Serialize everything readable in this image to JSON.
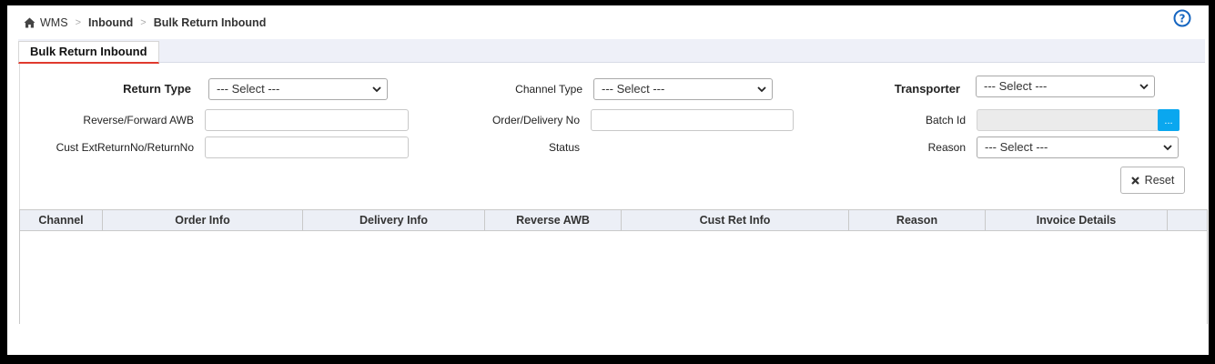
{
  "breadcrumb": {
    "root": "WMS",
    "sep": ">",
    "level1": "Inbound",
    "current": "Bulk Return Inbound"
  },
  "tab": {
    "label": "Bulk Return Inbound"
  },
  "filters": {
    "return_type": {
      "label": "Return Type",
      "value": "--- Select ---"
    },
    "channel_type": {
      "label": "Channel Type",
      "value": "--- Select ---"
    },
    "transporter": {
      "label": "Transporter",
      "value": "--- Select ---"
    },
    "reverse_awb": {
      "label": "Reverse/Forward AWB",
      "value": ""
    },
    "order_delivery": {
      "label": "Order/Delivery No",
      "value": ""
    },
    "batch_id": {
      "label": "Batch Id",
      "value": "",
      "button": "..."
    },
    "cust_ret": {
      "label": "Cust ExtReturnNo/ReturnNo",
      "value": ""
    },
    "status": {
      "label": "Status"
    },
    "reason": {
      "label": "Reason",
      "value": "--- Select ---"
    }
  },
  "reset_label": "Reset",
  "columns": [
    "Channel",
    "Order Info",
    "Delivery Info",
    "Reverse AWB",
    "Cust Ret Info",
    "Reason",
    "Invoice Details"
  ],
  "colors": {
    "accent": "#0aa7ef",
    "help": "#1565c0",
    "tab_underline": "#e03a2e"
  }
}
